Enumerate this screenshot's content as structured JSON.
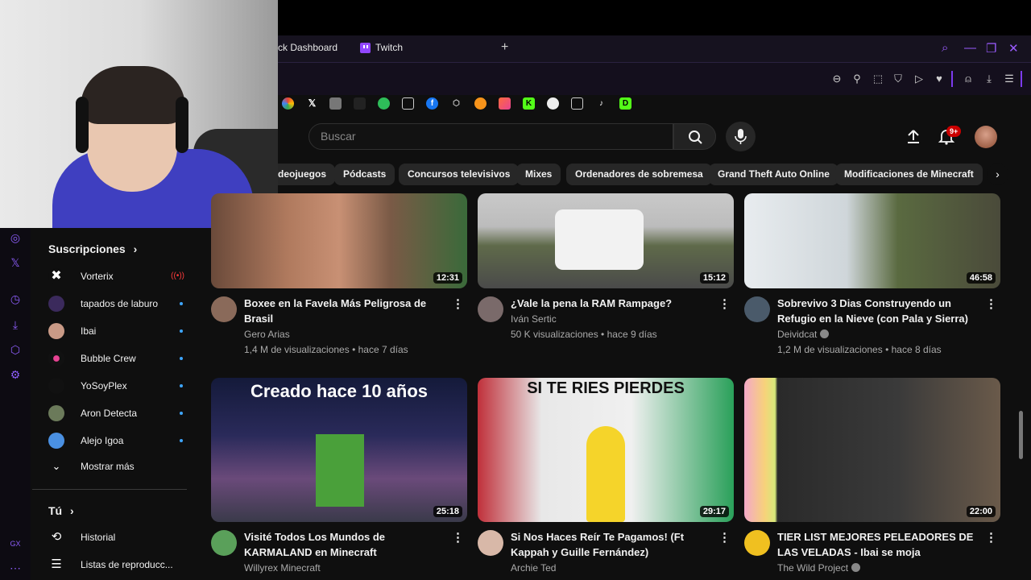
{
  "browser": {
    "tabs": [
      {
        "label": "ck Dashboard"
      },
      {
        "label": "Twitch"
      }
    ],
    "new_tab": "+"
  },
  "youtube": {
    "search_placeholder": "Buscar",
    "notifications_badge": "9+",
    "chips": [
      "deojuegos",
      "Pódcasts",
      "Concursos televisivos",
      "Mixes",
      "Ordenadores de sobremesa",
      "Grand Theft Auto Online",
      "Modificaciones de Minecraft"
    ]
  },
  "sidebar": {
    "subscriptions_title": "Suscripciones",
    "channels": [
      {
        "name": "Vorterix",
        "indicator": "live"
      },
      {
        "name": "tapados de laburo",
        "indicator": "new"
      },
      {
        "name": "Ibai",
        "indicator": "new"
      },
      {
        "name": "Bubble Crew",
        "indicator": "new"
      },
      {
        "name": "YoSoyPlex",
        "indicator": "new"
      },
      {
        "name": "Aron Detecta",
        "indicator": "new"
      },
      {
        "name": "Alejo Igoa",
        "indicator": "new"
      }
    ],
    "show_more": "Mostrar más",
    "you_title": "Tú",
    "you_items": [
      {
        "label": "Historial"
      },
      {
        "label": "Listas de reproducc..."
      }
    ]
  },
  "videos": [
    {
      "title": "Boxee en la Favela Más Peligrosa de Brasil",
      "channel": "Gero Arias",
      "verified": false,
      "meta": "1,4 M de visualizaciones • hace 7 días",
      "duration": "12:31"
    },
    {
      "title": "¿Vale la pena la RAM Rampage?",
      "channel": "Iván Sertic",
      "verified": false,
      "meta": "50 K visualizaciones • hace 9 días",
      "duration": "15:12"
    },
    {
      "title": "Sobrevivo 3 Dias Construyendo un Refugio en la Nieve (con Pala y Sierra)",
      "channel": "Deividcat",
      "verified": true,
      "meta": "1,2 M de visualizaciones • hace 8 días",
      "duration": "46:58"
    },
    {
      "title": "Visité Todos Los Mundos de KARMALAND en Minecraft",
      "channel": "Willyrex Minecraft",
      "verified": false,
      "meta": "",
      "duration": "25:18",
      "thumb_text": "Creado hace 10 años"
    },
    {
      "title": "Si Nos Haces Reír Te Pagamos! (Ft Kappah y Guille Fernández)",
      "channel": "Archie Ted",
      "verified": false,
      "meta": "",
      "duration": "29:17",
      "thumb_text": "SI TE RIES PIERDES"
    },
    {
      "title": "TIER LIST MEJORES PELEADORES DE LAS VELADAS - Ibai se moja",
      "channel": "The Wild Project",
      "verified": true,
      "meta": "",
      "duration": "22:00"
    }
  ],
  "colors": {
    "accent": "#9146ff",
    "yt_red": "#cc0000",
    "link_blue": "#3ea6ff"
  }
}
